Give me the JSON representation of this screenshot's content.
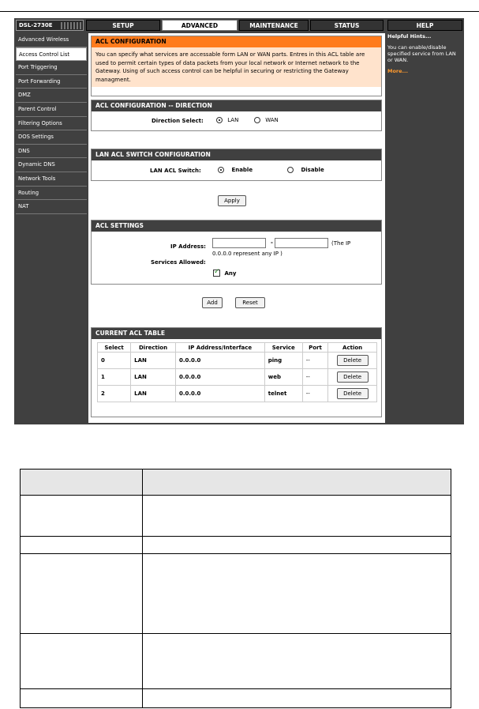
{
  "header": {
    "logo": "DSL-2730E",
    "tabs": [
      "SETUP",
      "ADVANCED",
      "MAINTENANCE",
      "STATUS",
      "HELP"
    ],
    "active_tab": "ADVANCED"
  },
  "sidebar": {
    "items": [
      "Advanced Wireless",
      "Access Control List",
      "Port Triggering",
      "Port Forwarding",
      "DMZ",
      "Parent Control",
      "Filtering Options",
      "DOS Settings",
      "DNS",
      "Dynamic DNS",
      "Network Tools",
      "Routing",
      "NAT"
    ],
    "active": "Access Control List"
  },
  "acl_config": {
    "title": "ACL CONFIGURATION",
    "description": "You can specify what services are accessable form LAN or WAN parts.  Entres in this ACL table are used to permit certain types of data packets from your local network or Internet network to the Gateway.  Using of such access control can be helpful in securing or restricting the Gateway managment."
  },
  "direction": {
    "title": "ACL CONFIGURATION -- DIRECTION",
    "label": "Direction Select:",
    "options": [
      "LAN",
      "WAN"
    ],
    "selected": "LAN"
  },
  "lan_switch": {
    "title": "LAN ACL SWITCH CONFIGURATION",
    "label": "LAN ACL Switch:",
    "options": [
      "Enable",
      "Disable"
    ],
    "selected": "Enable"
  },
  "apply_label": "Apply",
  "acl_settings": {
    "title": "ACL SETTINGS",
    "ip_label": "IP Address:",
    "ip_start_value": "",
    "ip_end_value": "",
    "range_separator": "-",
    "ip_hint_1": "(The IP",
    "ip_hint_2": "0.0.0.0 represent any IP )",
    "services_label": "Services Allowed:",
    "any_label": "Any",
    "any_checked": true
  },
  "add_label": "Add",
  "reset_label": "Reset",
  "acl_table": {
    "title": "CURRENT ACL TABLE",
    "columns": [
      "Select",
      "Direction",
      "IP Address/Interface",
      "Service",
      "Port",
      "Action"
    ],
    "rows": [
      {
        "select": "0",
        "direction": "LAN",
        "ip": "0.0.0.0",
        "service": "ping",
        "port": "--",
        "action": "Delete"
      },
      {
        "select": "1",
        "direction": "LAN",
        "ip": "0.0.0.0",
        "service": "web",
        "port": "--",
        "action": "Delete"
      },
      {
        "select": "2",
        "direction": "LAN",
        "ip": "0.0.0.0",
        "service": "telnet",
        "port": "--",
        "action": "Delete"
      }
    ]
  },
  "help": {
    "title": "Helpful Hints...",
    "text": "You can enable/disable specified service from LAN or WAN.",
    "more": "More..."
  },
  "colors": {
    "orange_title": "#ff7b1c",
    "description_bg": "#ffe3cc",
    "dark_bar": "#404040",
    "more_link": "#ff9a2e"
  }
}
